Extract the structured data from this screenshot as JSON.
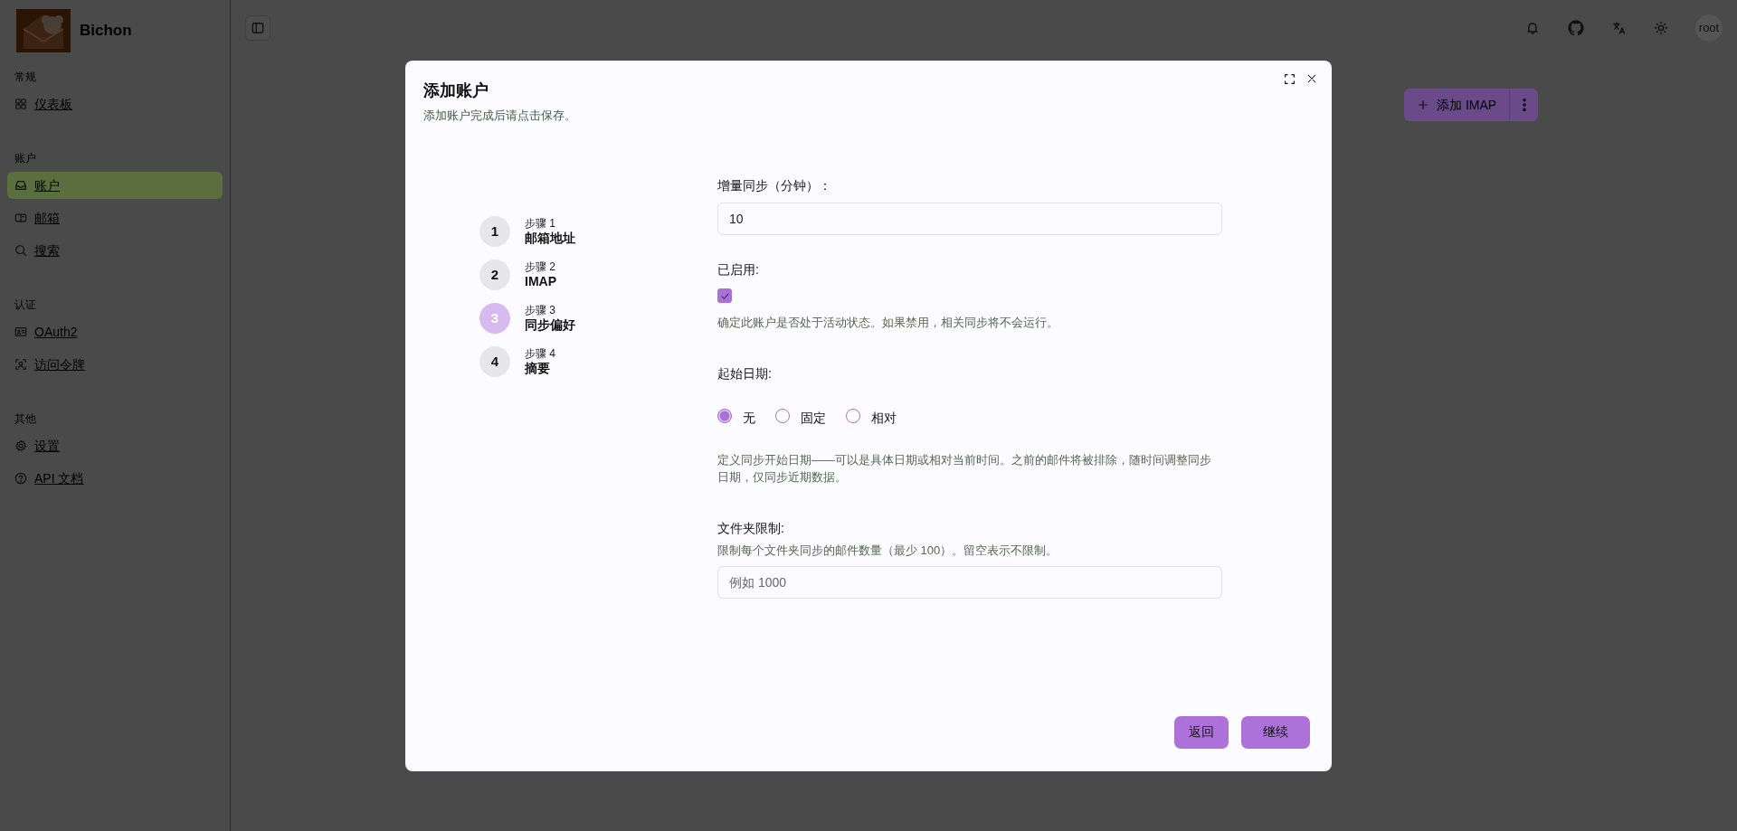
{
  "app": {
    "name": "Bichon"
  },
  "sidebar": {
    "sections": [
      {
        "title": "常规",
        "items": [
          {
            "label": "仪表板",
            "selected": false
          }
        ]
      },
      {
        "title": "账户",
        "items": [
          {
            "label": "账户",
            "selected": true
          },
          {
            "label": "邮箱",
            "selected": false
          },
          {
            "label": "搜索",
            "selected": false
          }
        ]
      },
      {
        "title": "认证",
        "items": [
          {
            "label": "OAuth2",
            "selected": false
          },
          {
            "label": "访问令牌",
            "selected": false
          }
        ]
      },
      {
        "title": "其他",
        "items": [
          {
            "label": "设置",
            "selected": false
          },
          {
            "label": "API 文档",
            "selected": false
          }
        ]
      }
    ]
  },
  "topbar": {
    "user": "root"
  },
  "toolbar": {
    "add_button": "添加 IMAP"
  },
  "dialog": {
    "title": "添加账户",
    "subtitle": "添加账户完成后请点击保存。",
    "steps": [
      {
        "number": "1",
        "caption": "步骤 1",
        "title": "邮箱地址",
        "selected": false
      },
      {
        "number": "2",
        "caption": "步骤 2",
        "title": "IMAP",
        "selected": false
      },
      {
        "number": "3",
        "caption": "步骤 3",
        "title": "同步偏好",
        "selected": true
      },
      {
        "number": "4",
        "caption": "步骤 4",
        "title": "摘要",
        "selected": false
      }
    ],
    "fields": [
      {
        "kind": "text",
        "label": "增量同步（分钟）：",
        "value": "10"
      },
      {
        "kind": "checkbox",
        "label": "已启用:",
        "checked": true,
        "help": "确定此账户是否处于活动状态。如果禁用，相关同步将不会运行。"
      },
      {
        "kind": "radio",
        "label": "起始日期:",
        "options": [
          {
            "label": "无",
            "selected": true
          },
          {
            "label": "固定",
            "selected": false
          },
          {
            "label": "相对",
            "selected": false
          }
        ],
        "help": "定义同步开始日期——可以是具体日期或相对当前时间。之前的邮件将被排除，随时间调整同步日期，仅同步近期数据。"
      },
      {
        "kind": "text",
        "label": "文件夹限制:",
        "help": "限制每个文件夹同步的邮件数量（最少 100）。留空表示不限制。",
        "placeholder": "例如 1000"
      }
    ],
    "buttons": {
      "back": "返回",
      "next": "继续"
    }
  }
}
